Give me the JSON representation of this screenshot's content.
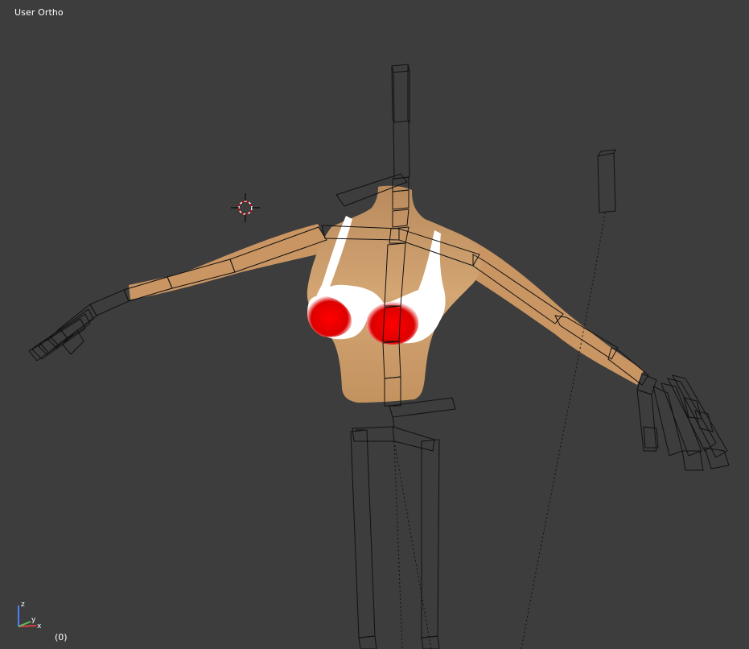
{
  "viewport": {
    "view_name": "User Ortho",
    "frame_indicator": "(0)"
  },
  "axis_gizmo": {
    "labels": {
      "x": "x",
      "y": "y",
      "z": "z"
    },
    "colors": {
      "x": "#d84040",
      "y": "#60c060",
      "z": "#4c7fff"
    }
  },
  "scene": {
    "object_model": "character-torso-mesh",
    "armature": "wireframe-armature",
    "colors": {
      "background": "#3d3d3d",
      "skin": "#c89a6a",
      "bra_white": "#ffffff",
      "bra_red": "#dd0000",
      "bone_wire": "#111111"
    }
  }
}
